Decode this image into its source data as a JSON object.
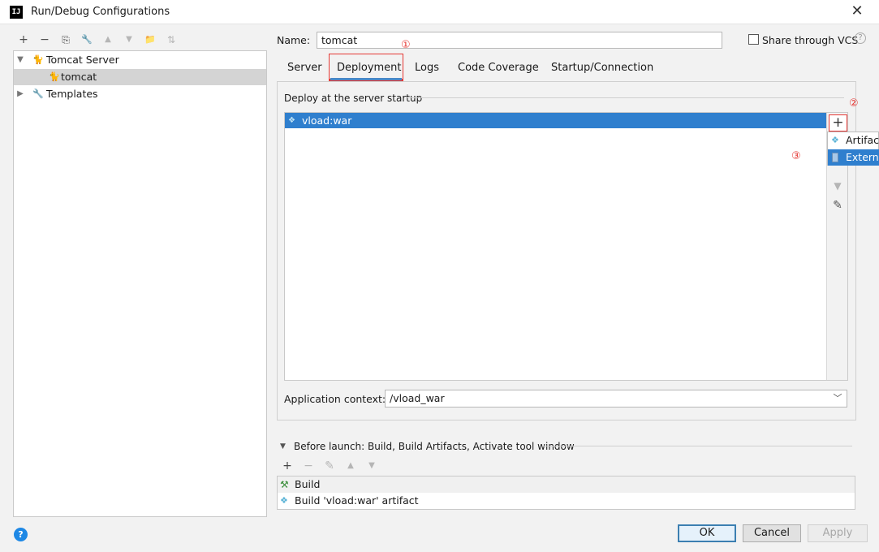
{
  "window": {
    "title": "Run/Debug Configurations",
    "app_icon": "IJ",
    "close": "✕"
  },
  "left_toolbar": [
    "+",
    "−",
    "⎘",
    "🔧",
    "▲",
    "▼",
    "📁",
    "⇅"
  ],
  "tree": {
    "items": [
      {
        "label": "Tomcat Server",
        "expanded": true
      },
      {
        "label": "tomcat",
        "selected": true
      },
      {
        "label": "Templates",
        "expanded": false
      }
    ]
  },
  "name_field": {
    "label": "Name:",
    "value": "tomcat"
  },
  "share": {
    "label": "Share through VCS",
    "checked": false,
    "help": "?"
  },
  "tabs": [
    {
      "label": "Server"
    },
    {
      "label": "Deployment",
      "active": true
    },
    {
      "label": "Logs"
    },
    {
      "label": "Code Coverage"
    },
    {
      "label": "Startup/Connection"
    }
  ],
  "deployment": {
    "group_label": "Deploy at the server startup",
    "items": [
      {
        "label": "vload:war",
        "selected": true
      }
    ],
    "add_button": "+",
    "popup": [
      {
        "label": "Artifact..."
      },
      {
        "label": "External Source...",
        "selected": true
      }
    ]
  },
  "annotations": [
    "①",
    "②",
    "③"
  ],
  "app_context": {
    "label": "Application context:",
    "value": "/vload_war"
  },
  "before_launch": {
    "label": "Before launch: Build, Build Artifacts, Activate tool window",
    "toolbar": [
      "+",
      "−",
      "✎",
      "▲",
      "▼"
    ],
    "items": [
      {
        "label": "Build"
      },
      {
        "label": "Build 'vload:war' artifact"
      }
    ]
  },
  "buttons": {
    "ok": "OK",
    "cancel": "Cancel",
    "apply": "Apply"
  },
  "help_icon": "?"
}
